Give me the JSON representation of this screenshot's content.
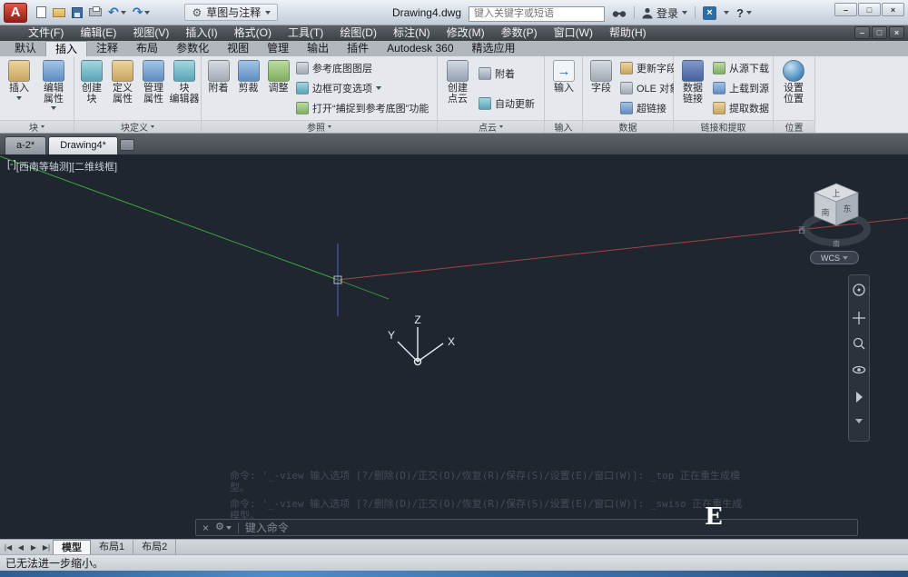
{
  "titlebar": {
    "workspace": "草图与注释",
    "doc_title": "Drawing4.dwg",
    "search_placeholder": "键入关键字或短语",
    "signin": "登录",
    "help": "?"
  },
  "menubar": {
    "items": [
      "文件(F)",
      "编辑(E)",
      "视图(V)",
      "插入(I)",
      "格式(O)",
      "工具(T)",
      "绘图(D)",
      "标注(N)",
      "修改(M)",
      "参数(P)",
      "窗口(W)",
      "帮助(H)"
    ]
  },
  "ribbon": {
    "active_tab": "插入",
    "tabs": [
      "默认",
      "插入",
      "注释",
      "布局",
      "参数化",
      "视图",
      "管理",
      "输出",
      "插件",
      "Autodesk 360",
      "精选应用"
    ],
    "panels": {
      "block": {
        "label": "块",
        "buttons": {
          "insert": "插入",
          "edit_attr": "编辑\n属性"
        }
      },
      "block_def": {
        "label": "块定义",
        "buttons": {
          "create": "创建\n块",
          "def_attr": "定义\n属性",
          "manage_attr": "管理\n属性",
          "editor": "块\n编辑器"
        }
      },
      "reference": {
        "label": "参照",
        "buttons": {
          "attach": "附着",
          "clip": "剪裁",
          "adjust": "调整",
          "underlay_layers": "参考底图图层",
          "frames": "边框可变选项",
          "snap_underlay": "打开“捕捉到参考底图”功能"
        }
      },
      "point_cloud": {
        "label": "点云",
        "buttons": {
          "create": "创建\n点云",
          "attach": "附着",
          "auto_update": "自动更新"
        }
      },
      "import": {
        "label": "输入",
        "buttons": {
          "import": "输入"
        }
      },
      "data": {
        "label": "数据",
        "buttons": {
          "field": "字段",
          "update_fields": "更新字段",
          "ole": "OLE 对象",
          "hyperlink": "超链接"
        }
      },
      "linking": {
        "label": "链接和提取",
        "buttons": {
          "data_link": "数据\n链接",
          "download": "从源下载",
          "upload": "上载到源",
          "extract": "提取数据"
        }
      },
      "location": {
        "label": "位置",
        "buttons": {
          "set_location": "设置\n位置"
        }
      }
    }
  },
  "file_tabs": {
    "tabs": [
      "a-2*",
      "Drawing4*"
    ],
    "active": "Drawing4*"
  },
  "canvas": {
    "viewport_controls": [
      "[-]",
      "[西南等轴测]",
      "[二维线框]"
    ],
    "ucs": {
      "x": "X",
      "y": "Y",
      "z": "Z"
    },
    "viewcube": {
      "top": "上",
      "left": "南",
      "right": "东",
      "compass_w": "西",
      "compass_s": "南",
      "ucs_menu": "WCS"
    },
    "history": [
      "命令: '_-view 输入选项 [?/删除(D)/正交(O)/恢复(R)/保存(S)/设置(E)/窗口(W)]: _top 正在重生成模",
      "型。",
      "命令: '_-view 输入选项 [?/删除(D)/正交(O)/恢复(R)/保存(S)/设置(E)/窗口(W)]: _swiso 正在重生成",
      "模型。"
    ],
    "command_placeholder": "键入命令",
    "watermark": "E"
  },
  "layoutbar": {
    "nav": [
      "|◀",
      "◀",
      "▶",
      "▶|"
    ],
    "tabs": [
      "模型",
      "布局1",
      "布局2"
    ],
    "active": "模型"
  },
  "statusbar": {
    "message": "已无法进一步缩小。"
  },
  "colors": {
    "canvas_bg": "#20262f",
    "axis_green": "#3da33d",
    "axis_red": "#a04545",
    "axis_blue": "#5560c8",
    "accent": "#2d6da3"
  }
}
